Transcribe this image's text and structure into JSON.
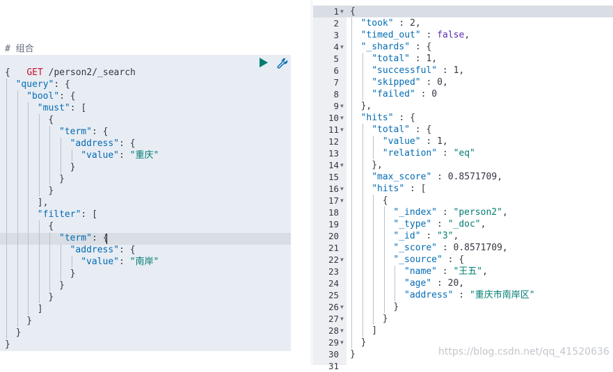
{
  "request": {
    "comment": "# 组合",
    "method": "GET",
    "path": "/person2/_search",
    "run_icon": "play-icon",
    "settings_icon": "wrench-icon",
    "lines": [
      [
        [
          "{",
          "punc"
        ]
      ],
      [
        [
          "\"query\"",
          "key"
        ],
        [
          ": {",
          "punc"
        ]
      ],
      [
        [
          "\"bool\"",
          "key"
        ],
        [
          ": {",
          "punc"
        ]
      ],
      [
        [
          "\"must\"",
          "key"
        ],
        [
          ": [",
          "punc"
        ]
      ],
      [
        [
          "{",
          "punc"
        ]
      ],
      [
        [
          "\"term\"",
          "key"
        ],
        [
          ": {",
          "punc"
        ]
      ],
      [
        [
          "\"address\"",
          "key"
        ],
        [
          ": {",
          "punc"
        ]
      ],
      [
        [
          "\"value\"",
          "key"
        ],
        [
          ": ",
          "punc"
        ],
        [
          "\"重庆\"",
          "str"
        ]
      ],
      [
        [
          "}",
          "punc"
        ]
      ],
      [
        [
          "}",
          "punc"
        ]
      ],
      [
        [
          "}",
          "punc"
        ]
      ],
      [
        [
          "],",
          "punc"
        ]
      ],
      [
        [
          "\"filter\"",
          "key"
        ],
        [
          ": [",
          "punc"
        ]
      ],
      [
        [
          "{",
          "punc"
        ]
      ],
      [
        [
          "\"term\"",
          "key"
        ],
        [
          ": {",
          "punc"
        ]
      ],
      [
        [
          "\"address\"",
          "key"
        ],
        [
          ": {",
          "punc"
        ]
      ],
      [
        [
          "\"value\"",
          "key"
        ],
        [
          ": ",
          "punc"
        ],
        [
          "\"南岸\"",
          "str"
        ]
      ],
      [
        [
          "}",
          "punc"
        ]
      ],
      [
        [
          "}",
          "punc"
        ]
      ],
      [
        [
          "}",
          "punc"
        ]
      ],
      [
        [
          "]",
          "punc"
        ]
      ],
      [
        [
          "}",
          "punc"
        ]
      ],
      [
        [
          "}",
          "punc"
        ]
      ],
      [
        [
          "}",
          "punc"
        ]
      ]
    ]
  },
  "response": {
    "line_numbers": [
      "1",
      "2",
      "3",
      "4",
      "5",
      "6",
      "7",
      "8",
      "9",
      "10",
      "11",
      "12",
      "13",
      "14",
      "15",
      "16",
      "17",
      "18",
      "19",
      "20",
      "21",
      "22",
      "23",
      "24",
      "25",
      "26",
      "27",
      "28",
      "29",
      "30",
      "31"
    ],
    "lines": [
      [
        [
          "{",
          "punc"
        ]
      ],
      [
        [
          "\"took\"",
          "key"
        ],
        [
          " : 2,",
          "punc"
        ]
      ],
      [
        [
          "\"timed_out\"",
          "key"
        ],
        [
          " : ",
          "punc"
        ],
        [
          "false",
          "kw"
        ],
        [
          ",",
          "punc"
        ]
      ],
      [
        [
          "\"_shards\"",
          "key"
        ],
        [
          " : {",
          "punc"
        ]
      ],
      [
        [
          "\"total\"",
          "key"
        ],
        [
          " : 1,",
          "punc"
        ]
      ],
      [
        [
          "\"successful\"",
          "key"
        ],
        [
          " : 1,",
          "punc"
        ]
      ],
      [
        [
          "\"skipped\"",
          "key"
        ],
        [
          " : 0,",
          "punc"
        ]
      ],
      [
        [
          "\"failed\"",
          "key"
        ],
        [
          " : 0",
          "punc"
        ]
      ],
      [
        [
          "},",
          "punc"
        ]
      ],
      [
        [
          "\"hits\"",
          "key"
        ],
        [
          " : {",
          "punc"
        ]
      ],
      [
        [
          "\"total\"",
          "key"
        ],
        [
          " : {",
          "punc"
        ]
      ],
      [
        [
          "\"value\"",
          "key"
        ],
        [
          " : 1,",
          "punc"
        ]
      ],
      [
        [
          "\"relation\"",
          "key"
        ],
        [
          " : ",
          "punc"
        ],
        [
          "\"eq\"",
          "str"
        ]
      ],
      [
        [
          "},",
          "punc"
        ]
      ],
      [
        [
          "\"max_score\"",
          "key"
        ],
        [
          " : 0.8571709,",
          "punc"
        ]
      ],
      [
        [
          "\"hits\"",
          "key"
        ],
        [
          " : [",
          "punc"
        ]
      ],
      [
        [
          "{",
          "punc"
        ]
      ],
      [
        [
          "\"_index\"",
          "key"
        ],
        [
          " : ",
          "punc"
        ],
        [
          "\"person2\"",
          "str"
        ],
        [
          ",",
          "punc"
        ]
      ],
      [
        [
          "\"_type\"",
          "key"
        ],
        [
          " : ",
          "punc"
        ],
        [
          "\"_doc\"",
          "str"
        ],
        [
          ",",
          "punc"
        ]
      ],
      [
        [
          "\"_id\"",
          "key"
        ],
        [
          " : ",
          "punc"
        ],
        [
          "\"3\"",
          "str"
        ],
        [
          ",",
          "punc"
        ]
      ],
      [
        [
          "\"_score\"",
          "key"
        ],
        [
          " : 0.8571709,",
          "punc"
        ]
      ],
      [
        [
          "\"_source\"",
          "key"
        ],
        [
          " : {",
          "punc"
        ]
      ],
      [
        [
          "\"name\"",
          "key"
        ],
        [
          " : ",
          "punc"
        ],
        [
          "\"王五\"",
          "str"
        ],
        [
          ",",
          "punc"
        ]
      ],
      [
        [
          "\"age\"",
          "key"
        ],
        [
          " : 20,",
          "punc"
        ]
      ],
      [
        [
          "\"address\"",
          "key"
        ],
        [
          " : ",
          "punc"
        ],
        [
          "\"重庆市南岸区\"",
          "str"
        ]
      ],
      [
        [
          "}",
          "punc"
        ]
      ],
      [
        [
          "}",
          "punc"
        ]
      ],
      [
        [
          "]",
          "punc"
        ]
      ],
      [
        [
          "}",
          "punc"
        ]
      ],
      [
        [
          "}",
          "punc"
        ]
      ],
      [
        [
          "",
          "punc"
        ]
      ]
    ],
    "fold_icon": "fold-caret-icon"
  },
  "watermark": "https://blog.csdn.net/qq_41520636"
}
